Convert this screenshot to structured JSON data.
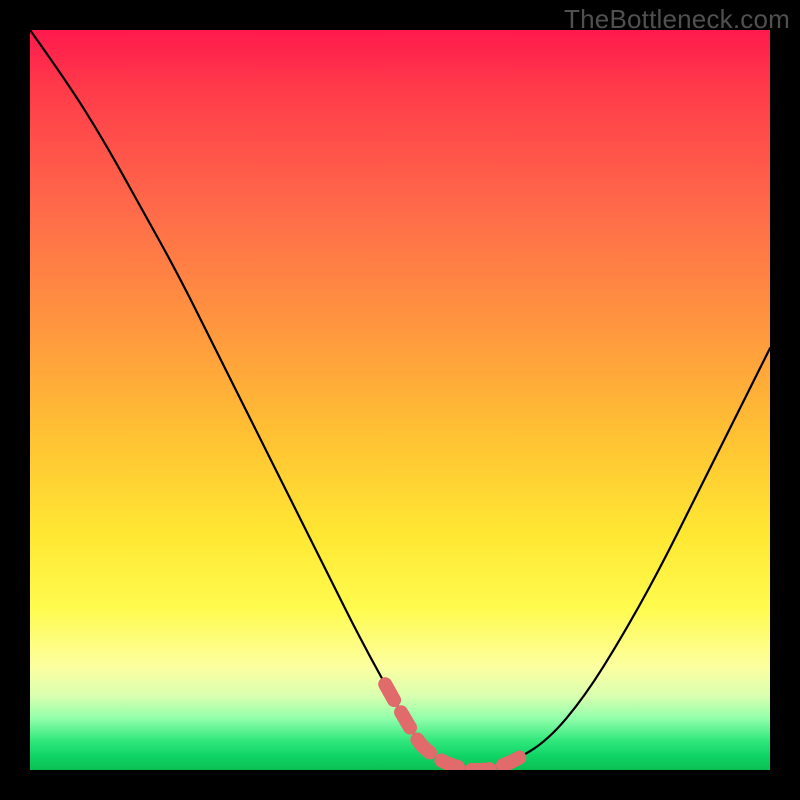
{
  "watermark": "TheBottleneck.com",
  "chart_data": {
    "type": "line",
    "title": "",
    "xlabel": "",
    "ylabel": "",
    "xlim": [
      0,
      100
    ],
    "ylim": [
      0,
      100
    ],
    "grid": false,
    "legend_position": "none",
    "series": [
      {
        "name": "bottleneck-curve",
        "x": [
          0,
          5,
          10,
          15,
          20,
          25,
          30,
          35,
          40,
          45,
          50,
          53,
          56,
          59,
          62,
          65,
          70,
          75,
          80,
          85,
          90,
          95,
          100
        ],
        "values": [
          100,
          93,
          85,
          76,
          67,
          57,
          47,
          37,
          27,
          17,
          8,
          3,
          1,
          0,
          0,
          1,
          4,
          10,
          18,
          27,
          37,
          47,
          57
        ]
      }
    ],
    "annotations": [
      {
        "name": "optimal-range-dashes",
        "kind": "dashed-segment-on-curve",
        "color": "#e16a6a",
        "x_range": [
          48,
          67
        ]
      }
    ],
    "background_gradient": {
      "direction": "vertical",
      "stops": [
        {
          "pos": 0.0,
          "color": "#ff1a4d"
        },
        {
          "pos": 0.24,
          "color": "#ff6a4a"
        },
        {
          "pos": 0.55,
          "color": "#ffc233"
        },
        {
          "pos": 0.78,
          "color": "#fffb4d"
        },
        {
          "pos": 0.93,
          "color": "#92ffab"
        },
        {
          "pos": 1.0,
          "color": "#0abf52"
        }
      ]
    }
  }
}
